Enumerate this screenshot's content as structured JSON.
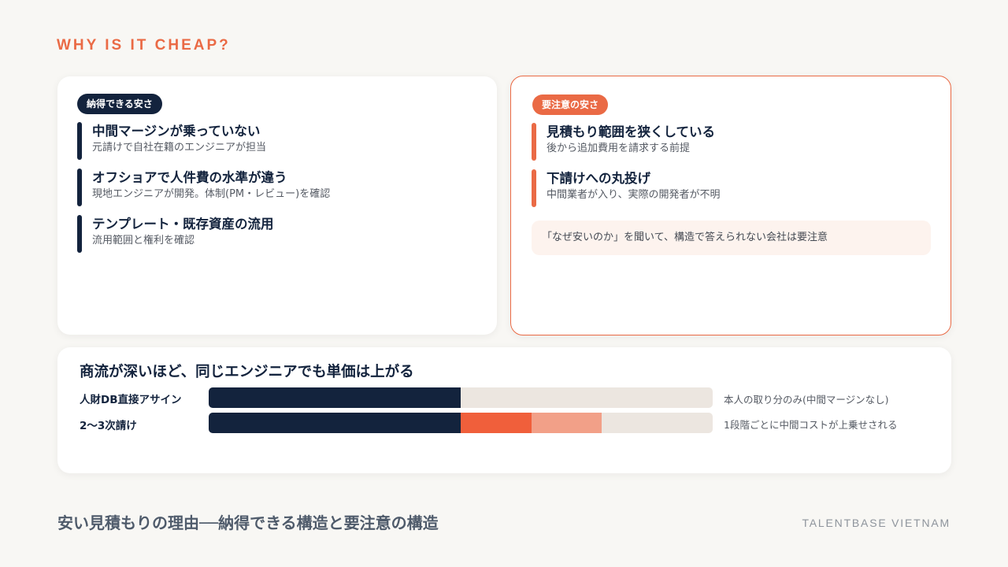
{
  "eyebrow": "WHY IS IT CHEAP?",
  "colors": {
    "navy": "#13233d",
    "accent": "#ea6a45",
    "accent_mid": "#f05f3b",
    "accent_light": "#f2a088",
    "track": "#ece6e0"
  },
  "good": {
    "badge": "納得できる安さ",
    "items": [
      {
        "title": "中間マージンが乗っていない",
        "desc": "元請けで自社在籍のエンジニアが担当"
      },
      {
        "title": "オフショアで人件費の水準が違う",
        "desc": "現地エンジニアが開発。体制(PM・レビュー)を確認"
      },
      {
        "title": "テンプレート・既存資産の流用",
        "desc": "流用範囲と権利を確認"
      }
    ]
  },
  "caution": {
    "badge": "要注意の安さ",
    "items": [
      {
        "title": "見積もり範囲を狭くしている",
        "desc": "後から追加費用を請求する前提"
      },
      {
        "title": "下請けへの丸投げ",
        "desc": "中間業者が入り、実際の開発者が不明"
      }
    ],
    "note": "「なぜ安いのか」を聞いて、構造で答えられない会社は要注意"
  },
  "comparison": {
    "title": "商流が深いほど、同じエンジニアでも単価は上がる",
    "rows": [
      {
        "label": "人財DB直接アサイン",
        "note": "本人の取り分のみ(中間マージンなし)",
        "segments": [
          {
            "share": 0.5,
            "color": "#13233d"
          }
        ]
      },
      {
        "label": "2〜3次請け",
        "note": "1段階ごとに中間コストが上乗せされる",
        "segments": [
          {
            "share": 0.5,
            "color": "#13233d"
          },
          {
            "share": 0.14,
            "color": "#f05f3b"
          },
          {
            "share": 0.14,
            "color": "#f2a088"
          }
        ]
      }
    ]
  },
  "footer": {
    "title": "安い見積もりの理由──納得できる構造と要注意の構造",
    "brand": "TALENTBASE VIETNAM"
  }
}
